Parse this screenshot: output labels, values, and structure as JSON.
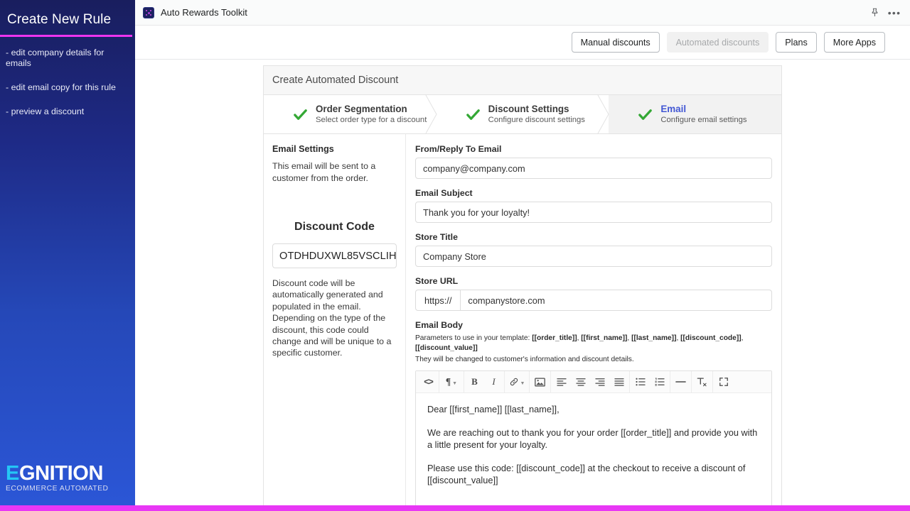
{
  "sidebar": {
    "title": "Create New Rule",
    "links": [
      "- edit company details for emails",
      "- edit email copy for this rule",
      "- preview a discount"
    ],
    "logo": {
      "accent_letter": "E",
      "rest": "GNITION",
      "tagline": "ECOMMERCE AUTOMATED"
    },
    "accent_color": "#ee35ee"
  },
  "topbar": {
    "app_title": "Auto Rewards Toolkit",
    "pin_icon": "pin-icon",
    "more_icon": "ellipsis-icon"
  },
  "actionbar": {
    "buttons": [
      {
        "label": "Manual discounts",
        "state": "enabled"
      },
      {
        "label": "Automated discounts",
        "state": "disabled"
      },
      {
        "label": "Plans",
        "state": "enabled"
      },
      {
        "label": "More Apps",
        "state": "enabled"
      }
    ]
  },
  "card": {
    "header": "Create Automated Discount",
    "steps": [
      {
        "name": "Order Segmentation",
        "desc": "Select order type for a discount",
        "active": false,
        "complete": true
      },
      {
        "name": "Discount Settings",
        "desc": "Configure discount settings",
        "active": false,
        "complete": true
      },
      {
        "name": "Email",
        "desc": "Configure email settings",
        "active": true,
        "complete": true
      }
    ],
    "active_step_color": "#4257d4",
    "check_color": "#34a835"
  },
  "left_column": {
    "heading": "Email Settings",
    "note": "This email will be sent to a customer from the order.",
    "discount_heading": "Discount Code",
    "discount_code": "OTDHDUXWL85VSCLIH",
    "discount_note": "Discount code will be automatically generated and populated in the email. Depending on the type of the discount, this code could change and will be unique to a specific customer."
  },
  "form": {
    "from_email": {
      "label": "From/Reply To Email",
      "value": "company@company.com"
    },
    "subject": {
      "label": "Email Subject",
      "value": "Thank you for your loyalty!"
    },
    "store_title": {
      "label": "Store Title",
      "value": "Company Store"
    },
    "store_url": {
      "label": "Store URL",
      "prefix": "https://",
      "value": "companystore.com"
    },
    "email_body": {
      "label": "Email Body",
      "params_prefix": "Parameters to use in your template: ",
      "params": [
        "[[order_title]]",
        "[[first_name]]",
        "[[last_name]]",
        "[[discount_code]]",
        "[[discount_value]]"
      ],
      "params_note": "They will be changed to customer's information and discount details.",
      "paragraphs": [
        "Dear [[first_name]] [[last_name]],",
        "We are reaching out to thank you for your order [[order_title]] and provide you with a little present for your loyalty.",
        "Please use this code: [[discount_code]] at the checkout to receive a discount of [[discount_value]]"
      ]
    }
  },
  "editor_toolbar": {
    "buttons": [
      "code-view-icon",
      "paragraph-format-icon",
      "bold-icon",
      "italic-icon",
      "link-icon",
      "insert-image-icon",
      "align-left-icon",
      "align-center-icon",
      "align-right-icon",
      "align-justify-icon",
      "unordered-list-icon",
      "ordered-list-icon",
      "horizontal-rule-icon",
      "clear-formatting-icon",
      "fullscreen-icon"
    ]
  }
}
